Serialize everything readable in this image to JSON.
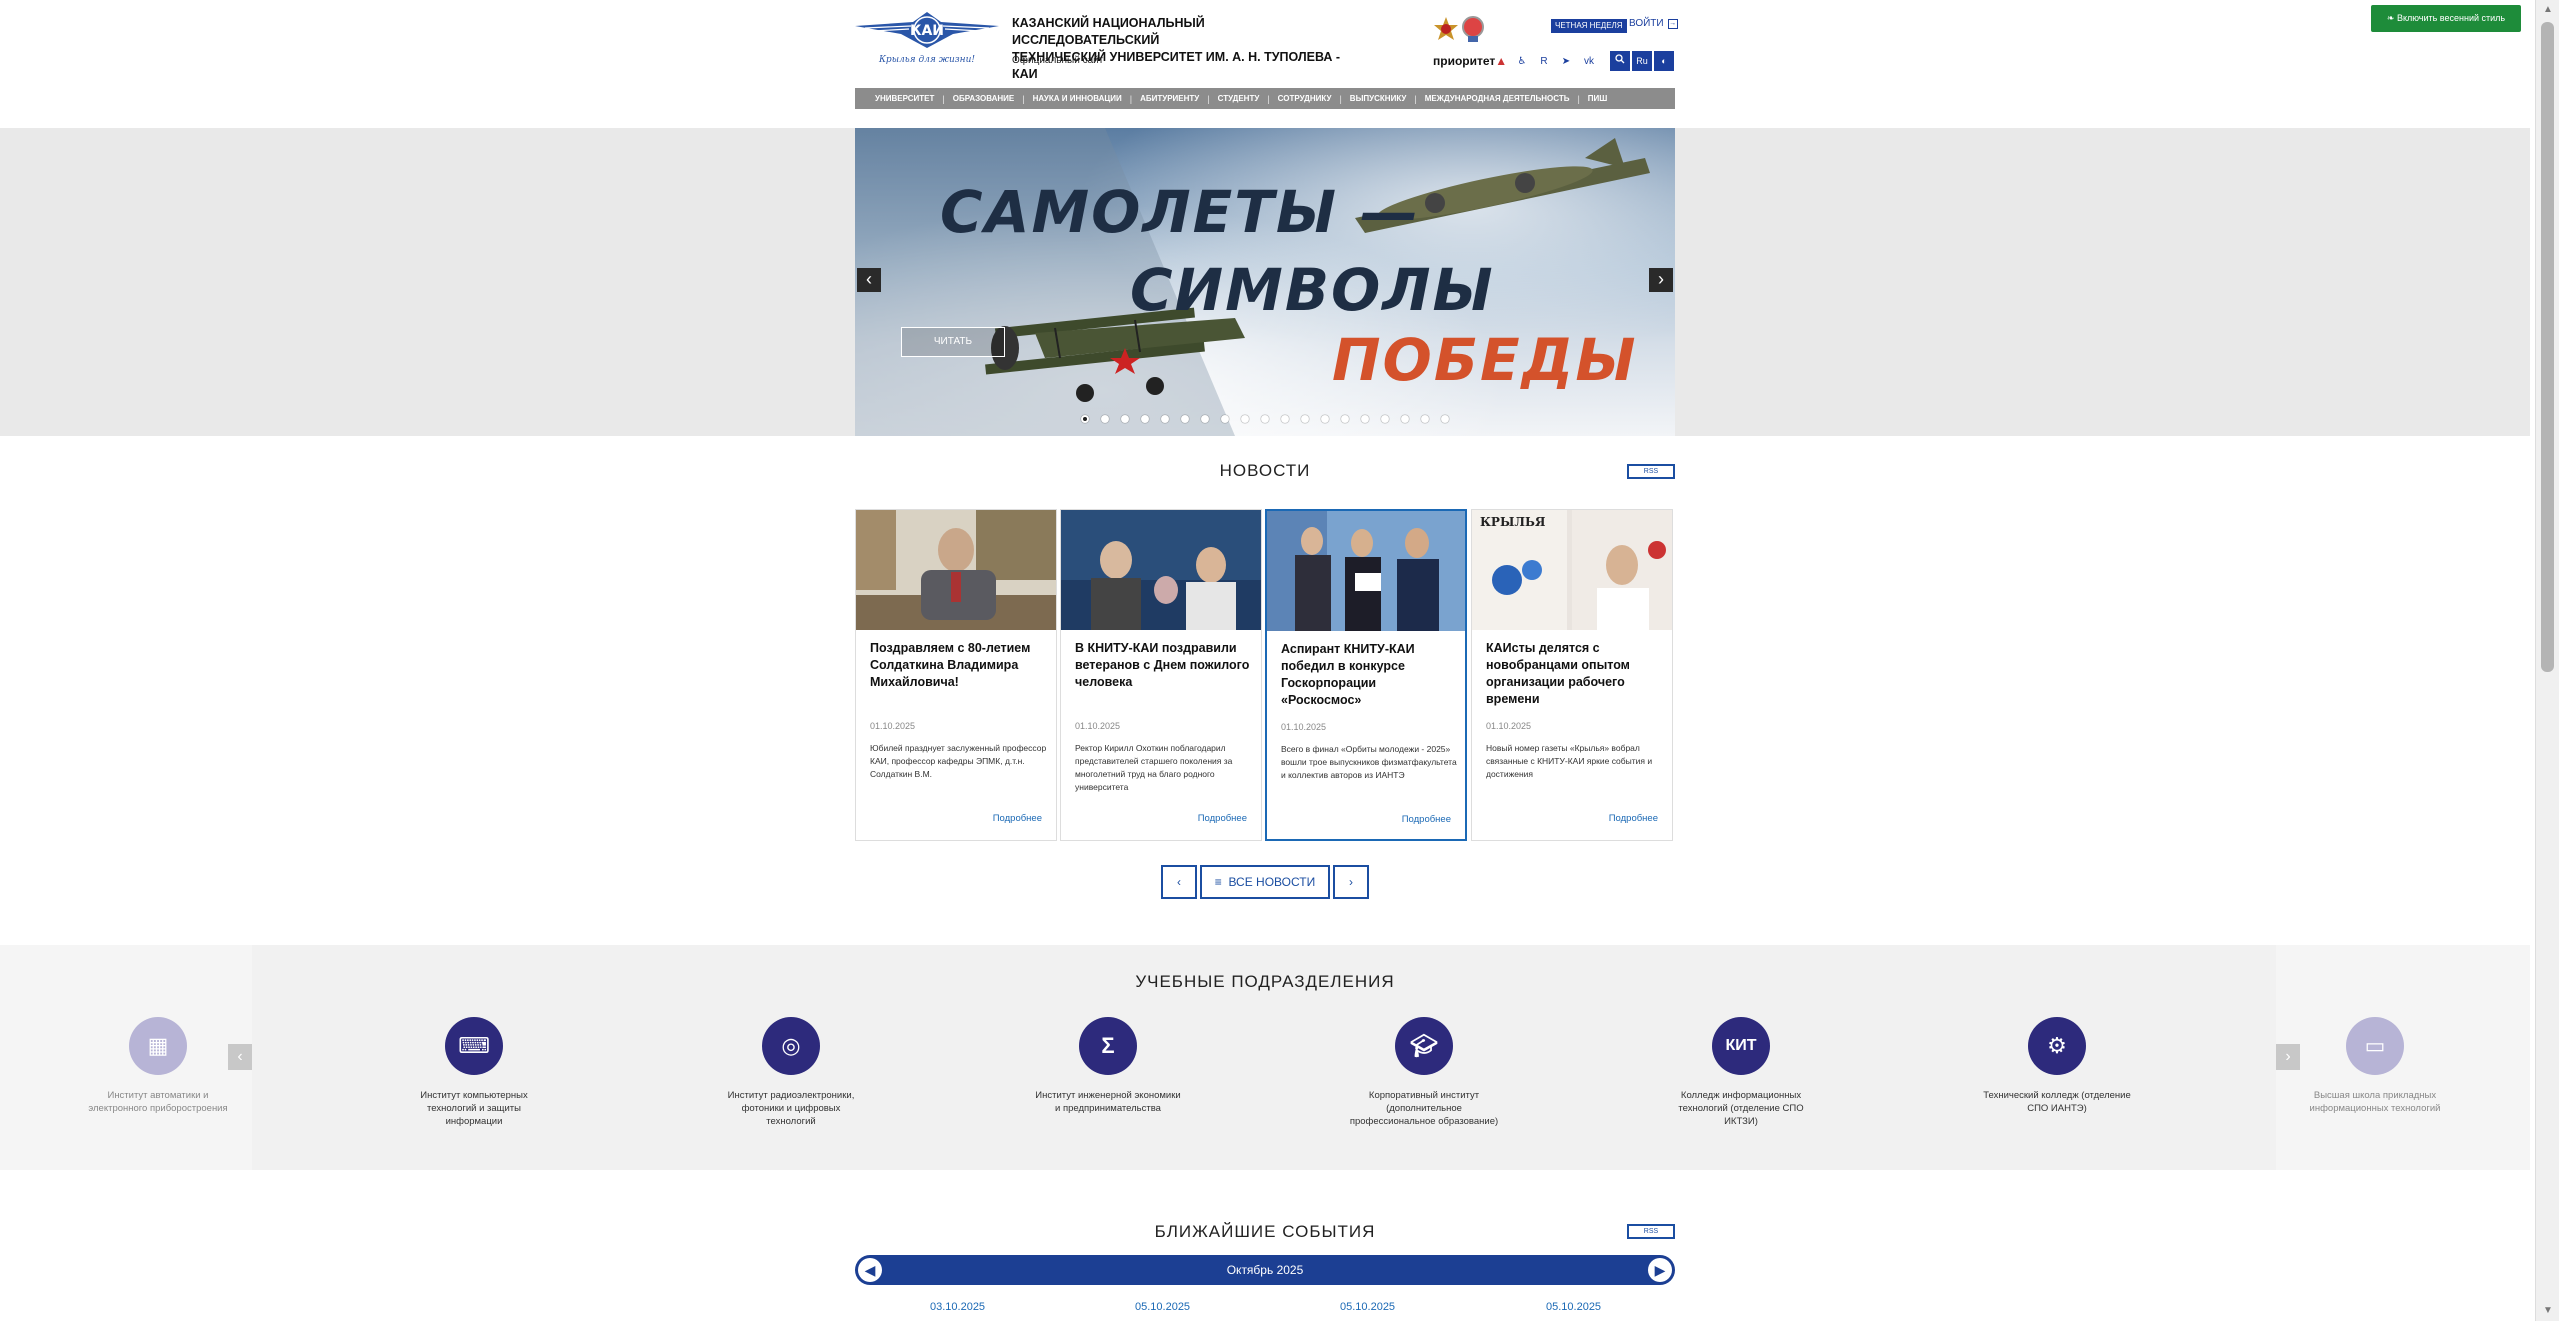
{
  "header": {
    "logo_text": "КАИ",
    "logo_tagline": "Крылья для жизни!",
    "university_name_line1": "КАЗАНСКИЙ НАЦИОНАЛЬНЫЙ ИССЛЕДОВАТЕЛЬСКИЙ",
    "university_name_line2": "ТЕХНИЧЕСКИЙ УНИВЕРСИТЕТ ИМ. А. Н. ТУПОЛЕВА - КАИ",
    "official_site": "Официальный сайт",
    "even_week": "ЧЕТНАЯ НЕДЕЛЯ",
    "login": "ВОЙТИ",
    "priority_label": "приоритет",
    "lang_label": "Ru",
    "spring_style_button": "Включить весенний стиль"
  },
  "nav": {
    "items": [
      "УНИВЕРСИТЕТ",
      "ОБРАЗОВАНИЕ",
      "НАУКА И ИННОВАЦИИ",
      "АБИТУРИЕНТУ",
      "СТУДЕНТУ",
      "СОТРУДНИКУ",
      "ВЫПУСКНИКУ",
      "МЕЖДУНАРОДНАЯ ДЕЯТЕЛЬНОСТЬ",
      "ПИШ"
    ]
  },
  "slider": {
    "line1": "САМОЛЕТЫ —",
    "line2": "СИМВОЛЫ",
    "line3": "ПОБЕДЫ",
    "read_button": "ЧИТАТЬ",
    "prev": "‹",
    "next": "›",
    "dot_count": 19,
    "active_dot": 0
  },
  "news": {
    "title": "НОВОСТИ",
    "rss": "RSS",
    "items": [
      {
        "title": "Поздравляем с 80-летием Солдаткина Владимира Михайловича!",
        "date": "01.10.2025",
        "excerpt": "Юбилей празднует заслуженный профессор КАИ, профессор кафедры ЭПМК, д.т.н. Солдаткин В.М.",
        "more": "Подробнее"
      },
      {
        "title": "В КНИТУ-КАИ поздравили ветеранов с Днем пожилого человека",
        "date": "01.10.2025",
        "excerpt": "Ректор Кирилл Охоткин поблагодарил представителей старшего поколения за многолетний труд на благо родного университета",
        "more": "Подробнее"
      },
      {
        "title": "Аспирант КНИТУ-КАИ победил в конкурсе Госкорпорации «Роскосмос»",
        "date": "01.10.2025",
        "excerpt": "Всего в финал «Орбиты молодежи - 2025» вошли трое выпускников физматфакультета и коллектив авторов из ИАНТЭ",
        "more": "Подробнее"
      },
      {
        "title": "КАИсты делятся с новобранцами опытом организации рабочего времени",
        "date": "01.10.2025",
        "excerpt": "Новый номер газеты «Крылья» вобрал связанные с КНИТУ-КАИ яркие события и достижения",
        "more": "Подробнее"
      }
    ],
    "all_news": "ВСЕ НОВОСТИ",
    "prev": "‹",
    "next": "›"
  },
  "divisions": {
    "title": "УЧЕБНЫЕ ПОДРАЗДЕЛЕНИЯ",
    "items": [
      {
        "label": "Институт автоматики и электронного приборостроения",
        "icon": "chip-icon"
      },
      {
        "label": "Институт компьютерных технологий и защиты информации",
        "icon": "computer-icon"
      },
      {
        "label": "Институт радиоэлектроники, фотоники и цифровых технологий",
        "icon": "radio-icon"
      },
      {
        "label": "Институт инженерной экономики и предпринимательства",
        "icon": "sigma-icon"
      },
      {
        "label": "Корпоративный институт (дополнительное профессиональное образование)",
        "icon": "graduation-cap-icon"
      },
      {
        "label": "Колледж информационных технологий (отделение СПО ИКТЗИ)",
        "icon": "kit-icon"
      },
      {
        "label": "Технический колледж (отделение СПО ИАНТЭ)",
        "icon": "gear-icon"
      },
      {
        "label": "Высшая школа прикладных информационных технологий",
        "icon": "laptop-icon"
      }
    ]
  },
  "events": {
    "title": "БЛИЖАЙШИЕ СОБЫТИЯ",
    "rss": "RSS",
    "month": "Октябрь 2025",
    "dates": [
      "03.10.2025",
      "05.10.2025",
      "05.10.2025",
      "05.10.2025"
    ]
  }
}
